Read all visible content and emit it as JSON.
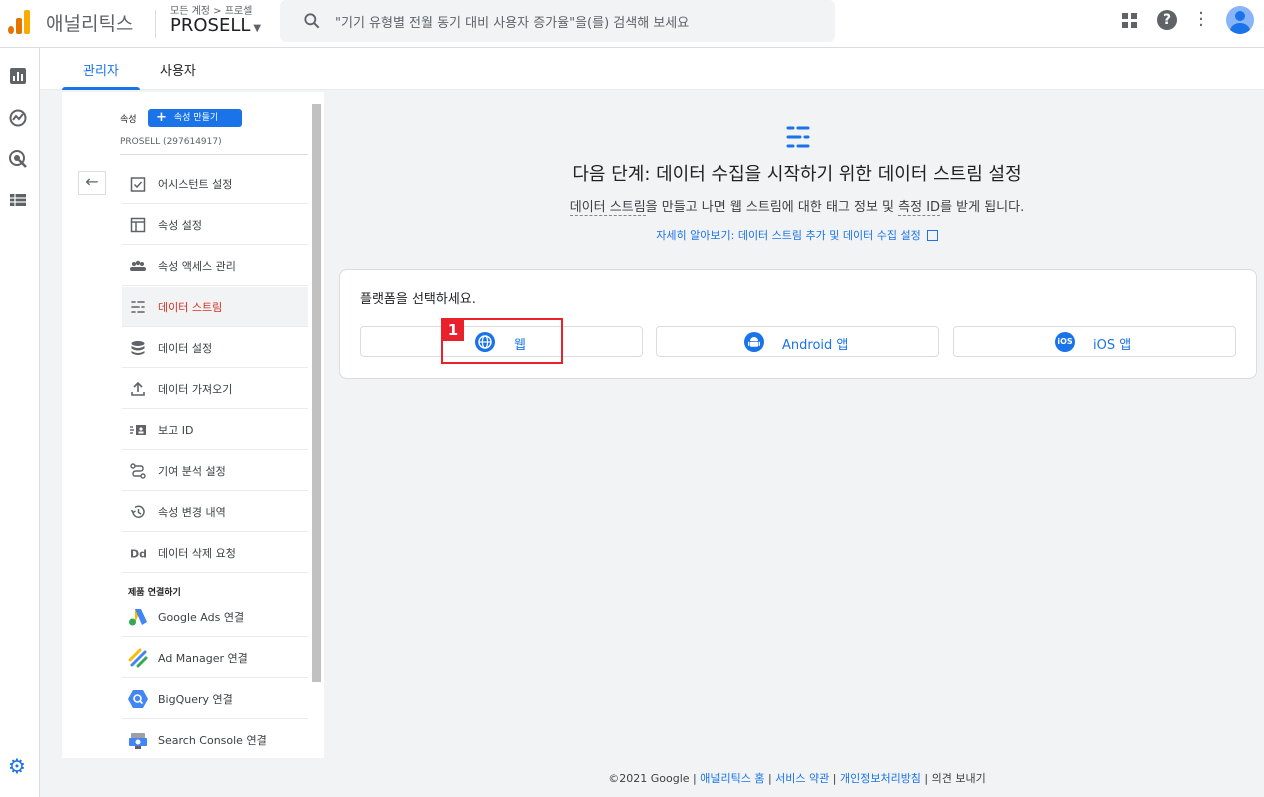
{
  "header": {
    "app_name": "애널리틱스",
    "breadcrumb": "모든 계정 > 프로셀",
    "account": "PROSELL",
    "search_placeholder": "\"기기 유형별 전월 동기 대비 사용자 증가율\"을(를) 검색해 보세요"
  },
  "tabs": [
    "관리자",
    "사용자"
  ],
  "panel": {
    "prop_label": "속성",
    "create_button": "속성 만들기",
    "prop_id": "PROSELL (297614917)",
    "items": [
      {
        "label": "어시스턴트 설정",
        "icon": "checklist-icon"
      },
      {
        "label": "속성 설정",
        "icon": "layout-icon"
      },
      {
        "label": "속성 액세스 관리",
        "icon": "people-icon"
      },
      {
        "label": "데이터 스트림",
        "icon": "streams-icon"
      },
      {
        "label": "데이터 설정",
        "icon": "database-icon"
      },
      {
        "label": "데이터 가져오기",
        "icon": "upload-icon"
      },
      {
        "label": "보고 ID",
        "icon": "report-id-icon"
      },
      {
        "label": "기여 분석 설정",
        "icon": "attribution-icon"
      },
      {
        "label": "속성 변경 내역",
        "icon": "history-icon"
      },
      {
        "label": "데이터 삭제 요청",
        "icon": "delete-request-icon"
      }
    ],
    "section": "제품 연결하기",
    "links": [
      {
        "label": "Google Ads 연결"
      },
      {
        "label": "Ad Manager 연결"
      },
      {
        "label": "BigQuery 연결"
      },
      {
        "label": "Search Console 연결"
      }
    ]
  },
  "main": {
    "title": "다음 단계: 데이터 수집을 시작하기 위한 데이터 스트림 설정",
    "sub_a": "데이터 스트림",
    "sub_b": "을 만들고 나면 웹 스트림에 대한 태그 정보 및 ",
    "sub_c": "측정 ID",
    "sub_d": "를 받게 됩니다.",
    "link": "자세히 알아보기: 데이터 스트림 추가 및 데이터 수집 설정",
    "card_title": "플랫폼을 선택하세요.",
    "platforms": [
      "웹",
      "Android 앱",
      "iOS 앱"
    ],
    "ios_icon_text": "iOS",
    "step_badge": "1"
  },
  "footer": {
    "copyright": "©2021 Google | ",
    "home": "애널리틱스 홈",
    "terms": "서비스 약관",
    "privacy": "개인정보처리방침",
    "feedback": "의견 보내기"
  },
  "colors": {
    "accent": "#1a73e8",
    "active": "#d93025",
    "highlight": "#e8212c"
  }
}
